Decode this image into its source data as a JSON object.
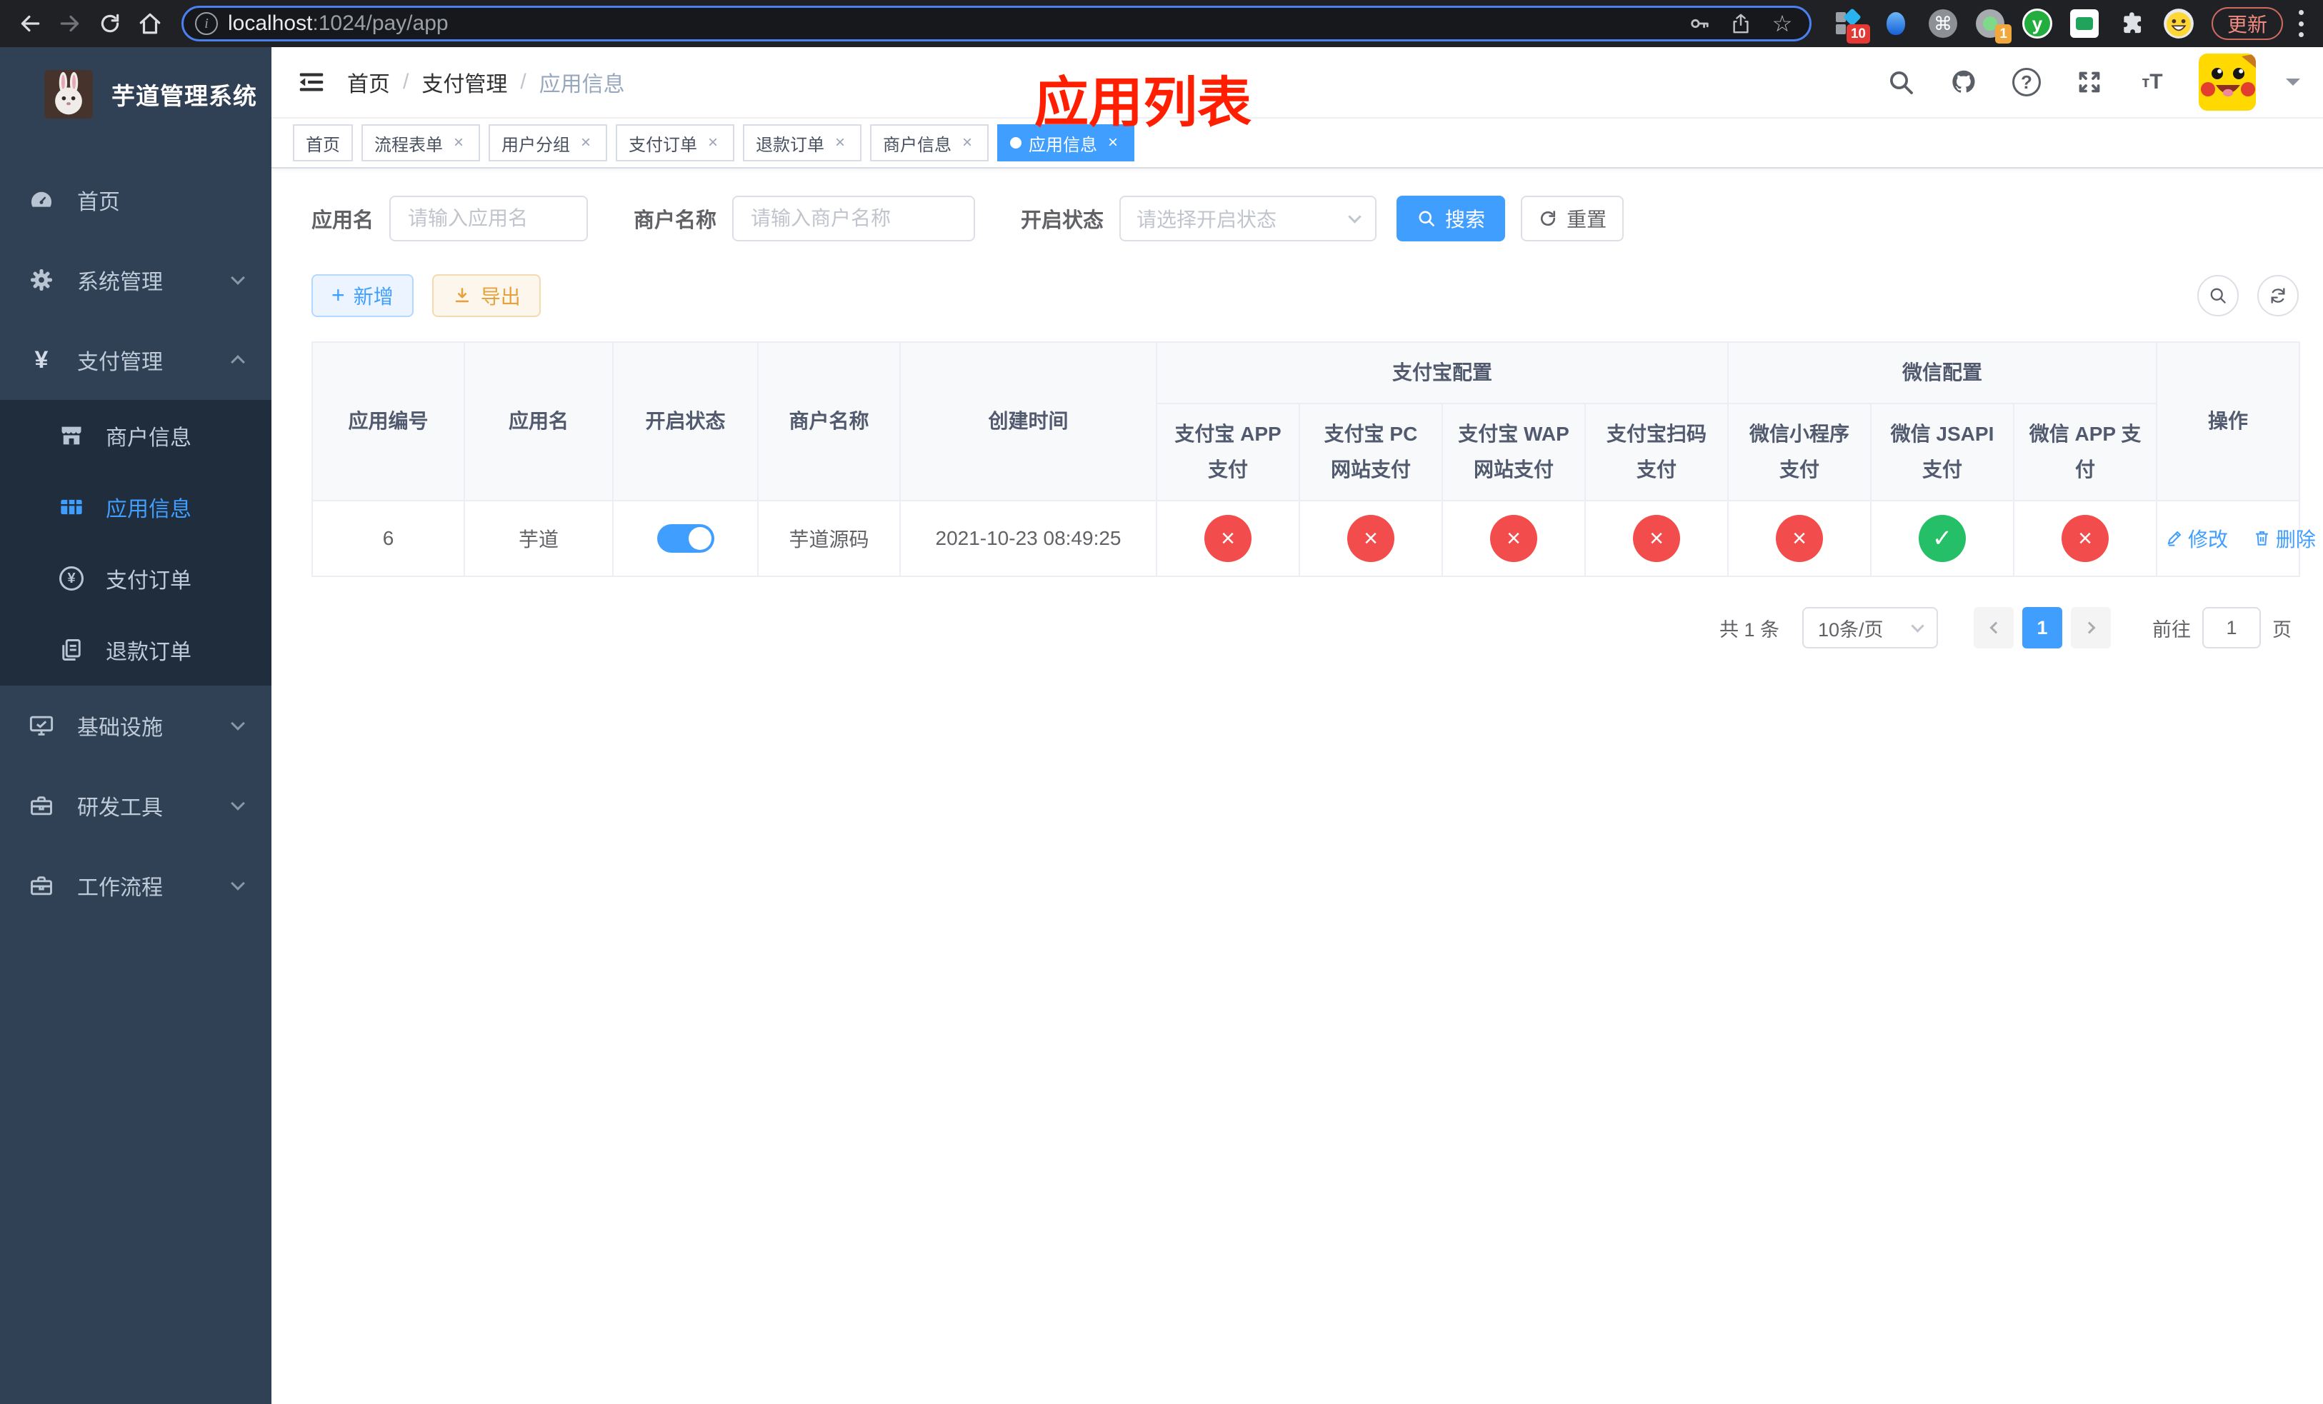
{
  "browser": {
    "url_host": "localhost",
    "url_path": ":1024/pay/app",
    "update_label": "更新",
    "badge_primary": "10",
    "badge_secondary": "1"
  },
  "sidebar": {
    "title": "芋道管理系统",
    "items": [
      {
        "label": "首页"
      },
      {
        "label": "系统管理"
      },
      {
        "label": "支付管理"
      },
      {
        "label": "基础设施"
      },
      {
        "label": "研发工具"
      },
      {
        "label": "工作流程"
      }
    ],
    "payment_children": [
      {
        "label": "商户信息"
      },
      {
        "label": "应用信息"
      },
      {
        "label": "支付订单"
      },
      {
        "label": "退款订单"
      }
    ]
  },
  "navbar": {
    "breadcrumb": [
      "首页",
      "支付管理",
      "应用信息"
    ],
    "overlay_title": "应用列表"
  },
  "tabs": {
    "items": [
      {
        "label": "首页"
      },
      {
        "label": "流程表单"
      },
      {
        "label": "用户分组"
      },
      {
        "label": "支付订单"
      },
      {
        "label": "退款订单"
      },
      {
        "label": "商户信息"
      },
      {
        "label": "应用信息"
      }
    ]
  },
  "filters": {
    "name_label": "应用名",
    "name_placeholder": "请输入应用名",
    "merchant_label": "商户名称",
    "merchant_placeholder": "请输入商户名称",
    "status_label": "开启状态",
    "status_placeholder": "请选择开启状态",
    "search_label": "搜索",
    "reset_label": "重置"
  },
  "toolbar": {
    "add_label": "新增",
    "export_label": "导出"
  },
  "table": {
    "columns": {
      "id": "应用编号",
      "name": "应用名",
      "status": "开启状态",
      "merchant": "商户名称",
      "created": "创建时间",
      "actions": "操作"
    },
    "groups": {
      "alipay": "支付宝配置",
      "wechat": "微信配置"
    },
    "subcolumns": [
      "支付宝 APP 支付",
      "支付宝 PC 网站支付",
      "支付宝 WAP 网站支付",
      "支付宝扫码支付",
      "微信小程序支付",
      "微信 JSAPI 支付",
      "微信 APP 支付"
    ],
    "row": {
      "id": "6",
      "name": "芋道",
      "status_enabled": true,
      "merchant": "芋道源码",
      "created": "2021-10-23 08:49:25",
      "channels": [
        {
          "name": "alipay-app",
          "enabled": false,
          "glyph": "×"
        },
        {
          "name": "alipay-pc",
          "enabled": false,
          "glyph": "×"
        },
        {
          "name": "alipay-wap",
          "enabled": false,
          "glyph": "×"
        },
        {
          "name": "alipay-qr",
          "enabled": false,
          "glyph": "×"
        },
        {
          "name": "wechat-lite",
          "enabled": false,
          "glyph": "×"
        },
        {
          "name": "wechat-jsapi",
          "enabled": true,
          "glyph": "✓"
        },
        {
          "name": "wechat-app",
          "enabled": false,
          "glyph": "×"
        }
      ],
      "edit_label": "修改",
      "delete_label": "删除"
    }
  },
  "pagination": {
    "total": "共 1 条",
    "page_size": "10条/页",
    "current_page": "1",
    "goto_label": "前往",
    "goto_value": "1",
    "page_unit": "页"
  }
}
